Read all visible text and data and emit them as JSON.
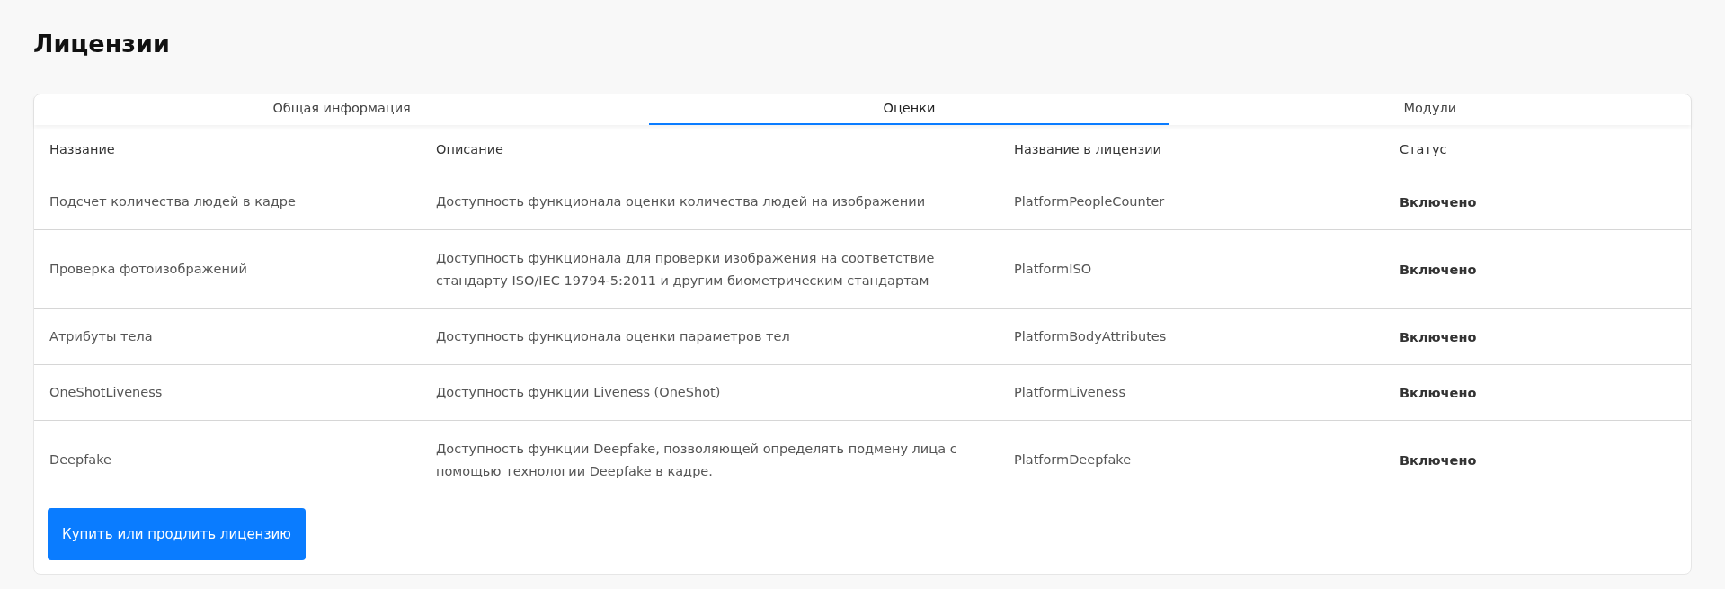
{
  "title": "Лицензии",
  "tabs": [
    {
      "label": "Общая информация",
      "selected": false
    },
    {
      "label": "Оценки",
      "selected": true
    },
    {
      "label": "Модули",
      "selected": false
    }
  ],
  "table": {
    "columns": [
      "Название",
      "Описание",
      "Название в лицензии",
      "Статус"
    ],
    "rows": [
      {
        "name": "Подсчет количества людей в кадре",
        "description": "Доступность функционала оценки количества людей на изображении",
        "license_name": "PlatformPeopleCounter",
        "status": "Включено"
      },
      {
        "name": "Проверка фотоизображений",
        "description": "Доступность функционала для проверки изображения на соответствие стандарту ISO/IEC 19794-5:2011 и другим биометрическим стандартам",
        "license_name": "PlatformISO",
        "status": "Включено"
      },
      {
        "name": "Атрибуты тела",
        "description": "Доступность функционала оценки параметров тел",
        "license_name": "PlatformBodyAttributes",
        "status": "Включено"
      },
      {
        "name": "OneShotLiveness",
        "description": "Доступность функции Liveness (OneShot)",
        "license_name": "PlatformLiveness",
        "status": "Включено"
      },
      {
        "name": "Deepfake",
        "description": "Доступность функции Deepfake, позволяющей определять подмену лица с помощью технологии Deepfake в кадре.",
        "license_name": "PlatformDeepfake",
        "status": "Включено"
      }
    ]
  },
  "button": "Купить или продлить лицензию"
}
